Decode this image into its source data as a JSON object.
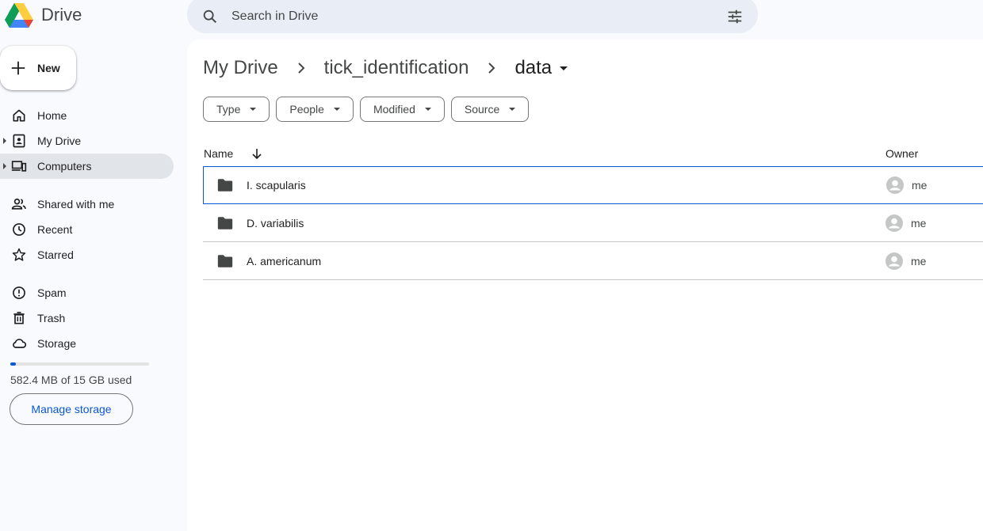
{
  "app": {
    "name": "Drive"
  },
  "search": {
    "placeholder": "Search in Drive"
  },
  "new_button": {
    "label": "New"
  },
  "sidebar": {
    "items": [
      {
        "label": "Home",
        "icon": "home-icon"
      },
      {
        "label": "My Drive",
        "icon": "my-drive-icon"
      },
      {
        "label": "Computers",
        "icon": "computers-icon"
      },
      {
        "label": "Shared with me",
        "icon": "shared-icon"
      },
      {
        "label": "Recent",
        "icon": "clock-icon"
      },
      {
        "label": "Starred",
        "icon": "star-icon"
      },
      {
        "label": "Spam",
        "icon": "spam-icon"
      },
      {
        "label": "Trash",
        "icon": "trash-icon"
      },
      {
        "label": "Storage",
        "icon": "cloud-icon"
      }
    ]
  },
  "storage": {
    "text": "582.4 MB of 15 GB used",
    "used_fraction": 0.038,
    "manage_label": "Manage storage"
  },
  "breadcrumb": {
    "root": "My Drive",
    "folder": "tick_identification",
    "current": "data"
  },
  "filters": [
    "Type",
    "People",
    "Modified",
    "Source"
  ],
  "table": {
    "name_header": "Name",
    "owner_header": "Owner",
    "rows": [
      {
        "name": "I. scapularis",
        "owner": "me"
      },
      {
        "name": "D. variabilis",
        "owner": "me"
      },
      {
        "name": "A. americanum",
        "owner": "me"
      }
    ]
  },
  "colors": {
    "accent": "#0b57d0",
    "background": "#f8fafd",
    "active_nav": "#e1e5ea"
  }
}
